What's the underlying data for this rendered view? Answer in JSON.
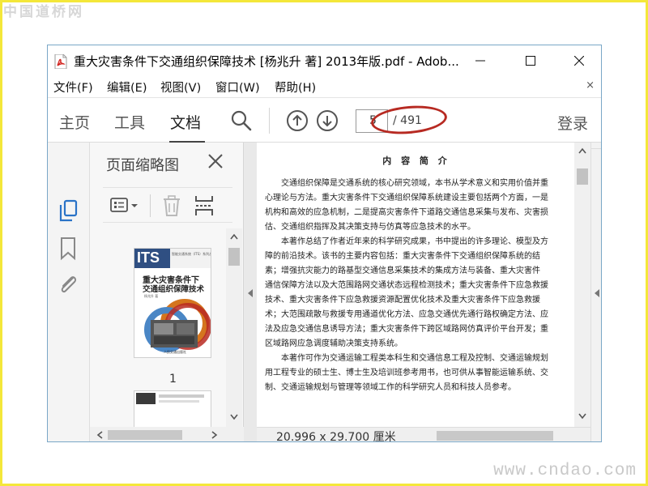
{
  "watermarks": {
    "top_left": "中国道桥网",
    "bottom_right": "www.cndao.com"
  },
  "window": {
    "title": "重大灾害条件下交通组织保障技术 [杨兆升 著] 2013年版.pdf - Adob...",
    "controls": [
      "minimize",
      "maximize",
      "close"
    ]
  },
  "menu": {
    "items": [
      "文件(F)",
      "编辑(E)",
      "视图(V)",
      "窗口(W)",
      "帮助(H)"
    ],
    "close_glyph": "×"
  },
  "toolbar": {
    "tabs": [
      "主页",
      "工具",
      "文档"
    ],
    "active_tab": "文档",
    "icons": [
      "search-icon",
      "page-up-icon",
      "page-down-icon"
    ],
    "current_page": "5",
    "total_pages": "/ 491",
    "login_label": "登录",
    "highlight_color": "#b72a22"
  },
  "panel": {
    "title": "页面缩略图",
    "close_glyph": "✕",
    "tool_icons": [
      "thumbnail-options-icon",
      "delete-page-icon",
      "insert-page-icon"
    ],
    "thumbnails": [
      {
        "label": "1",
        "cover_series": "智能交通系统（ITS）系列丛书",
        "cover_logo": "ITS",
        "cover_title_line1": "重大灾害条件下",
        "cover_title_line2": "交通组织保障技术",
        "cover_author": "杨兆升 著",
        "cover_publisher": "人民交通出版社"
      }
    ]
  },
  "document": {
    "heading": "内 容 简 介",
    "paragraphs": [
      [
        "　　交通组织保障是交通系统的核心研究领域，本书从学术意义和实用价值并重",
        "心理论与方法。重大灾害条件下交通组织保障系统建设主要包括两个方面，一是",
        "机构和高效的应急机制，二是提高灾害条件下道路交通信息采集与发布、灾害损",
        "估、交通组织指挥及其决策支持与仿真等应急技术的水平。"
      ],
      [
        "　　本著作总结了作者近年来的科学研究成果，书中提出的许多理论、模型及方",
        "障的前沿技术。该书的主要内容包括：重大灾害条件下交通组织保障系统的结",
        "素；增强抗灾能力的路基型交通信息采集技术的集成方法与装备、重大灾害件",
        "通信保障方法以及大范围路网交通状态远程检测技术；重大灾害条件下应急救援",
        "技术、重大灾害条件下应急救援资源配置优化技术及重大灾害条件下应急救援",
        "术；大范围疏散与救援专用通道优化方法、应急交通优先通行路权确定方法、应",
        "法及应急交通信息诱导方法；重大灾害条件下跨区域路网仿真评价平台开发；重",
        "区域路网应急调度辅助决策支持系统。"
      ],
      [
        "　　本著作可作为交通运输工程类本科生和交通信息工程及控制、交通运输规划",
        "用工程专业的硕士生、博士生及培训班参考用书，也可供从事智能运输系统、交",
        "制、交通运输规划与管理等领域工作的科学研究人员和科技人员参考。"
      ]
    ],
    "page_size": "20.996 x 29.700 厘米"
  }
}
